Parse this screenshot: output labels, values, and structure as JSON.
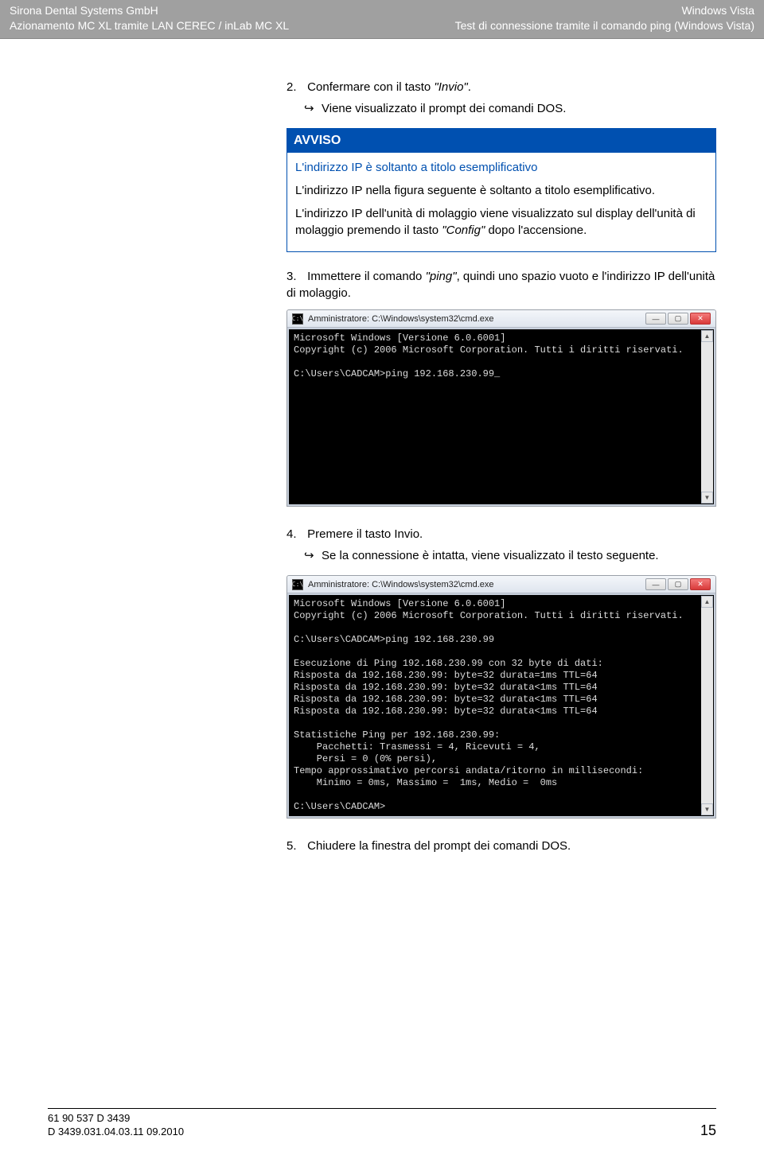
{
  "header": {
    "left1": "Sirona Dental Systems GmbH",
    "left2": "Azionamento MC XL tramite LAN CEREC / inLab MC XL",
    "right1": "Windows Vista",
    "right2": "Test di connessione tramite il comando ping (Windows Vista)"
  },
  "steps": {
    "s2_num": "2.",
    "s2_text_a": "Confermare con il tasto ",
    "s2_text_b": "\"Invio\"",
    "s2_text_c": ".",
    "s2_arrow": "Viene visualizzato il prompt dei comandi DOS.",
    "s3_num": "3.",
    "s3_text_a": "Immettere il comando ",
    "s3_text_b": "\"ping\"",
    "s3_text_c": ", quindi uno spazio vuoto e l'indirizzo IP dell'unità di molaggio.",
    "s4_num": "4.",
    "s4_text": "Premere il tasto Invio.",
    "s4_arrow": "Se la connessione è intatta, viene visualizzato il testo seguente.",
    "s5_num": "5.",
    "s5_text": "Chiudere la finestra del prompt dei comandi DOS."
  },
  "notice": {
    "title": "AVVISO",
    "heading": "L'indirizzo IP è soltanto a titolo esemplificativo",
    "p1": "L'indirizzo IP nella figura seguente è soltanto a titolo esemplificativo.",
    "p2_a": "L'indirizzo IP dell'unità di molaggio viene visualizzato sul display dell'unità di molaggio premendo il tasto ",
    "p2_b": "\"Config\"",
    "p2_c": " dopo l'accensione."
  },
  "console1": {
    "title": "Amministratore: C:\\Windows\\system32\\cmd.exe",
    "icon_glyph": "C:\\",
    "lines": "Microsoft Windows [Versione 6.0.6001]\nCopyright (c) 2006 Microsoft Corporation. Tutti i diritti riservati.\n\nC:\\Users\\CADCAM>ping 192.168.230.99_"
  },
  "console2": {
    "title": "Amministratore: C:\\Windows\\system32\\cmd.exe",
    "icon_glyph": "C:\\",
    "lines": "Microsoft Windows [Versione 6.0.6001]\nCopyright (c) 2006 Microsoft Corporation. Tutti i diritti riservati.\n\nC:\\Users\\CADCAM>ping 192.168.230.99\n\nEsecuzione di Ping 192.168.230.99 con 32 byte di dati:\nRisposta da 192.168.230.99: byte=32 durata=1ms TTL=64\nRisposta da 192.168.230.99: byte=32 durata<1ms TTL=64\nRisposta da 192.168.230.99: byte=32 durata<1ms TTL=64\nRisposta da 192.168.230.99: byte=32 durata<1ms TTL=64\n\nStatistiche Ping per 192.168.230.99:\n    Pacchetti: Trasmessi = 4, Ricevuti = 4,\n    Persi = 0 (0% persi),\nTempo approssimativo percorsi andata/ritorno in millisecondi:\n    Minimo = 0ms, Massimo =  1ms, Medio =  0ms\n\nC:\\Users\\CADCAM>"
  },
  "winbtns": {
    "min": "—",
    "max": "▢",
    "close": "✕"
  },
  "footer": {
    "code1": "61 90 537 D 3439",
    "code2": "D 3439.031.04.03.11   09.2010",
    "page": "15"
  }
}
